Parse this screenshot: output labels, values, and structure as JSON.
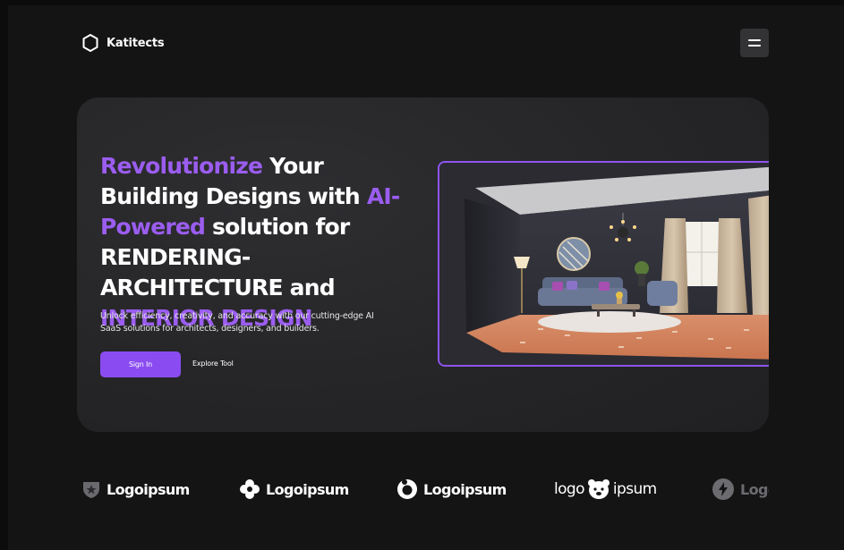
{
  "brand": {
    "name": "Katitects",
    "logo_icon": "hexagon-icon"
  },
  "menu": {
    "icon": "hamburger-menu-icon"
  },
  "hero": {
    "headline": {
      "p1": "Revolutionize",
      "p2": " Your Building Designs with ",
      "p3": "AI-Powered",
      "p4": " solution for RENDERING-ARCHITECTURE and ",
      "p5": "INTERIOR DESIGN"
    },
    "subtitle": "Unlock efficiency, creativity,  and accuracy with our cutting-edge AI SaaS solutions for architects, designers, and builders.",
    "primary_button": "Sign In",
    "secondary_link": "Explore Tool",
    "image_alt": "living-room-render-image"
  },
  "partner_logos": [
    {
      "label": "Logoipsum",
      "icon": "shield-logo-icon"
    },
    {
      "label": "Logoipsum",
      "icon": "flower-logo-icon"
    },
    {
      "label": "Logoipsum",
      "icon": "ring-logo-icon"
    },
    {
      "label_left": "logo",
      "label_right": "ipsum",
      "icon": "bear-logo-icon"
    },
    {
      "label": "Logoipsum",
      "icon": "bolt-logo-icon"
    }
  ],
  "colors": {
    "accent": "#8a4cf0",
    "headline_purple": "#9b5df0",
    "background": "#141415",
    "card": "#262628"
  }
}
